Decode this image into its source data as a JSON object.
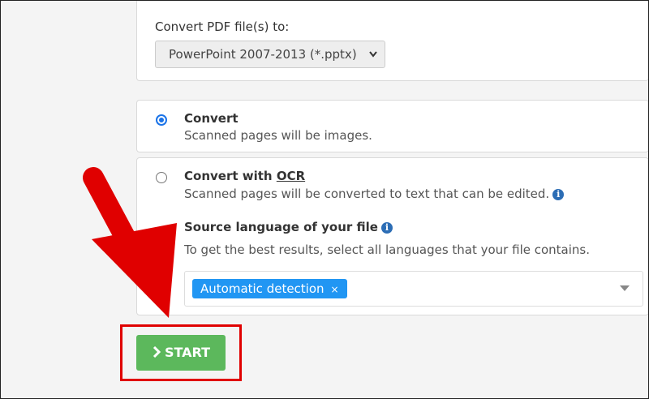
{
  "convert_to": {
    "label": "Convert PDF file(s) to:",
    "selected": "PowerPoint 2007-2013 (*.pptx)"
  },
  "options": [
    {
      "title": "Convert",
      "desc": "Scanned pages will be images.",
      "checked": true
    },
    {
      "title_pre": "Convert with ",
      "title_ocr": "OCR",
      "desc": "Scanned pages will be converted to text that can be edited.",
      "checked": false
    }
  ],
  "source_language": {
    "title": "Source language of your file",
    "help": "To get the best results, select all languages that your file contains.",
    "tag": "Automatic detection",
    "tag_remove": "×"
  },
  "start_button": {
    "label": "START",
    "icon": "chevron-right-icon",
    "color": "#5cb85c"
  },
  "annotation": {
    "arrow_color": "#e00000",
    "box_color": "#e00000"
  },
  "icons": {
    "info": "i"
  }
}
